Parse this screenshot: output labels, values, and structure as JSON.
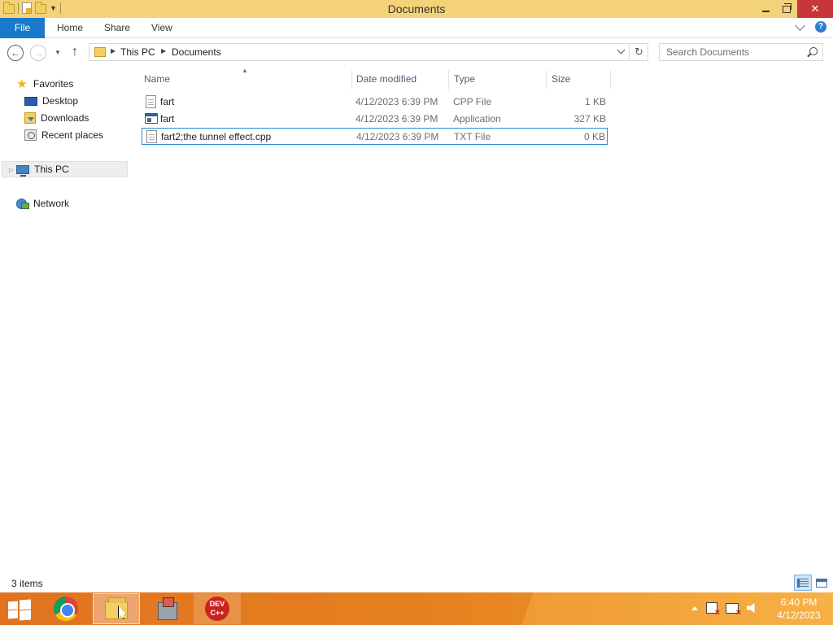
{
  "window": {
    "title": "Documents",
    "close_glyph": "✕"
  },
  "ribbon": {
    "tabs": [
      {
        "label": "File"
      },
      {
        "label": "Home"
      },
      {
        "label": "Share"
      },
      {
        "label": "View"
      }
    ]
  },
  "address": {
    "segments": [
      "This PC",
      "Documents"
    ],
    "search_placeholder": "Search Documents"
  },
  "nav_pane": {
    "favorites": "Favorites",
    "favorites_items": [
      "Desktop",
      "Downloads",
      "Recent places"
    ],
    "this_pc": "This PC",
    "network": "Network"
  },
  "file_list": {
    "columns": [
      "Name",
      "Date modified",
      "Type",
      "Size"
    ],
    "rows": [
      {
        "name": "fart",
        "date": "4/12/2023 6:39 PM",
        "type": "CPP File",
        "size": "1 KB",
        "icon": "text-file-icon"
      },
      {
        "name": "fart",
        "date": "4/12/2023 6:39 PM",
        "type": "Application",
        "size": "327 KB",
        "icon": "application-icon"
      },
      {
        "name": "fart2;the tunnel effect.cpp",
        "date": "4/12/2023 6:39 PM",
        "type": "TXT File",
        "size": "0 KB",
        "icon": "text-file-icon",
        "selected": true
      }
    ]
  },
  "status": {
    "item_count": "3 items"
  },
  "taskbar": {
    "apps": [
      "chrome-icon",
      "file-explorer-icon",
      "installer-icon",
      "dev-cpp-icon"
    ],
    "devcpp_label_1": "DEV",
    "devcpp_label_2": "C++",
    "clock_time": "6:40 PM",
    "clock_date": "4/12/2023"
  },
  "colors": {
    "title_bar": "#f4d27a",
    "file_tab": "#1979ca",
    "selection_border": "#2a8ad4",
    "taskbar": "#e5801f"
  }
}
